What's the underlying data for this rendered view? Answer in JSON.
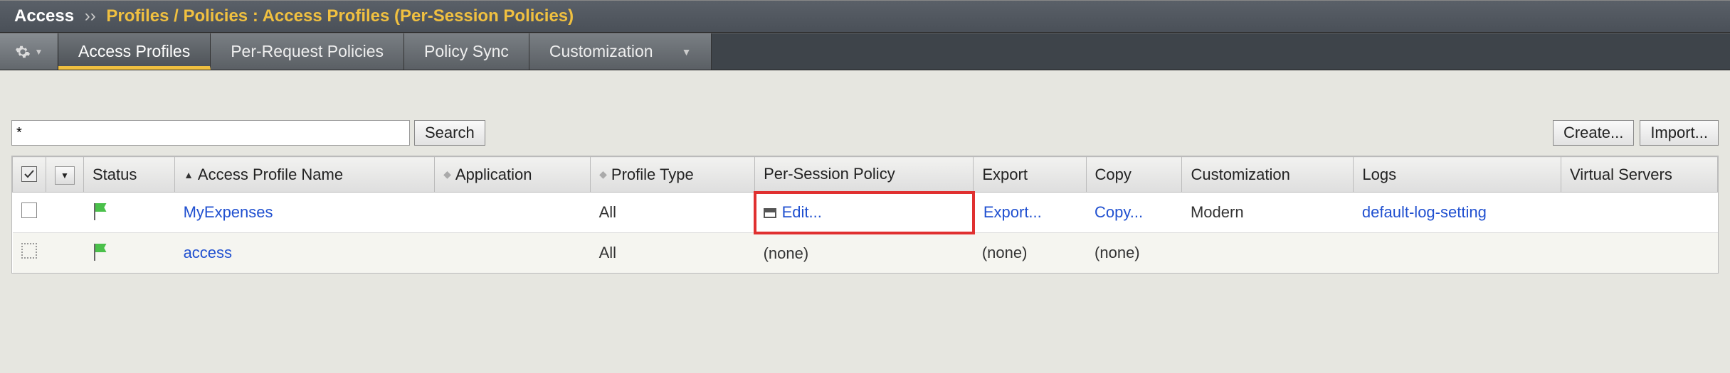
{
  "breadcrumb": {
    "root": "Access",
    "sep": "››",
    "path": "Profiles / Policies : Access Profiles (Per-Session Policies)"
  },
  "tabs": {
    "items": [
      {
        "label": "Access Profiles",
        "active": true,
        "dropdown": false
      },
      {
        "label": "Per-Request Policies",
        "active": false,
        "dropdown": false
      },
      {
        "label": "Policy Sync",
        "active": false,
        "dropdown": false
      },
      {
        "label": "Customization",
        "active": false,
        "dropdown": true
      }
    ]
  },
  "search": {
    "value": "*",
    "button": "Search"
  },
  "actions": {
    "create": "Create...",
    "import": "Import..."
  },
  "columns": {
    "status": "Status",
    "name": "Access Profile Name",
    "application": "Application",
    "profile_type": "Profile Type",
    "per_session": "Per-Session Policy",
    "export": "Export",
    "copy": "Copy",
    "customization": "Customization",
    "logs": "Logs",
    "virtual_servers": "Virtual Servers"
  },
  "rows": [
    {
      "selectable": "box",
      "name": "MyExpenses",
      "application": "",
      "profile_type": "All",
      "per_session": "Edit...",
      "per_session_highlight": true,
      "per_session_icon": true,
      "export": "Export...",
      "export_link": true,
      "copy": "Copy...",
      "copy_link": true,
      "customization": "Modern",
      "logs": "default-log-setting",
      "logs_link": true,
      "virtual_servers": ""
    },
    {
      "selectable": "dotted",
      "name": "access",
      "application": "",
      "profile_type": "All",
      "per_session": "(none)",
      "per_session_highlight": false,
      "per_session_icon": false,
      "export": "(none)",
      "export_link": false,
      "copy": "(none)",
      "copy_link": false,
      "customization": "",
      "logs": "",
      "logs_link": false,
      "virtual_servers": ""
    }
  ]
}
